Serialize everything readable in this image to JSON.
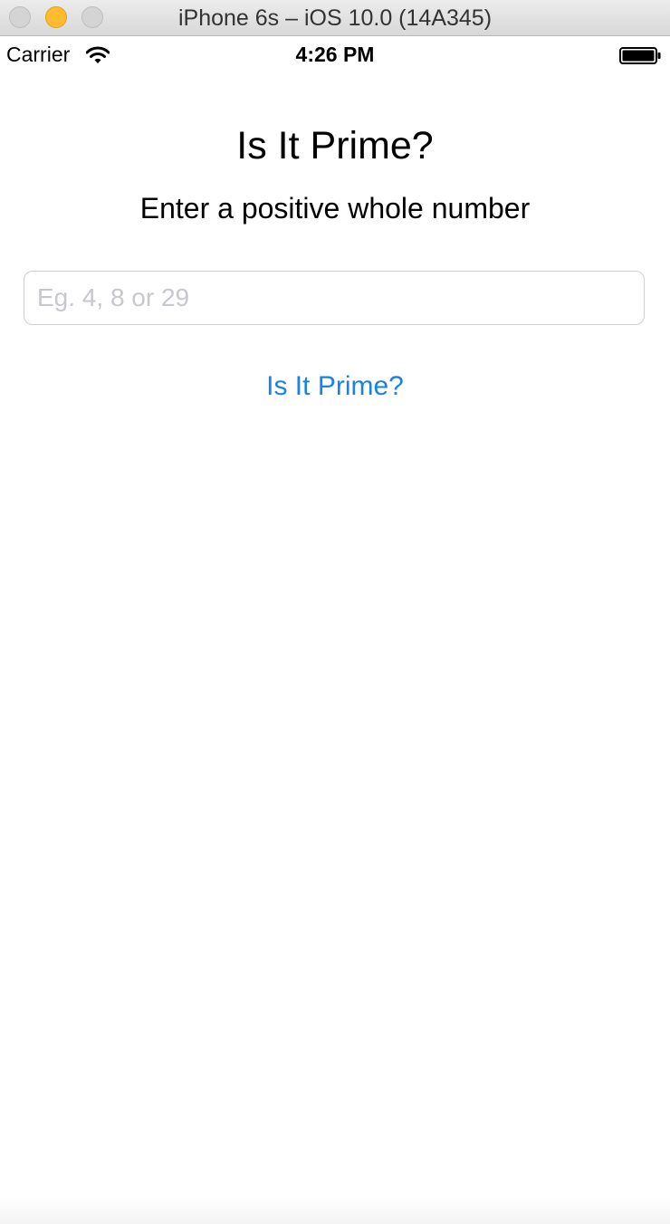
{
  "window": {
    "title": "iPhone 6s – iOS 10.0 (14A345)"
  },
  "status_bar": {
    "carrier": "Carrier",
    "time": "4:26 PM",
    "icons": [
      "wifi-icon",
      "battery-icon"
    ]
  },
  "app": {
    "title": "Is It Prime?",
    "instructions": "Enter a positive whole number",
    "input": {
      "value": "",
      "placeholder": "Eg. 4, 8 or 29"
    },
    "check_button_label": "Is It Prime?",
    "accent_color": "#1a82e2"
  }
}
